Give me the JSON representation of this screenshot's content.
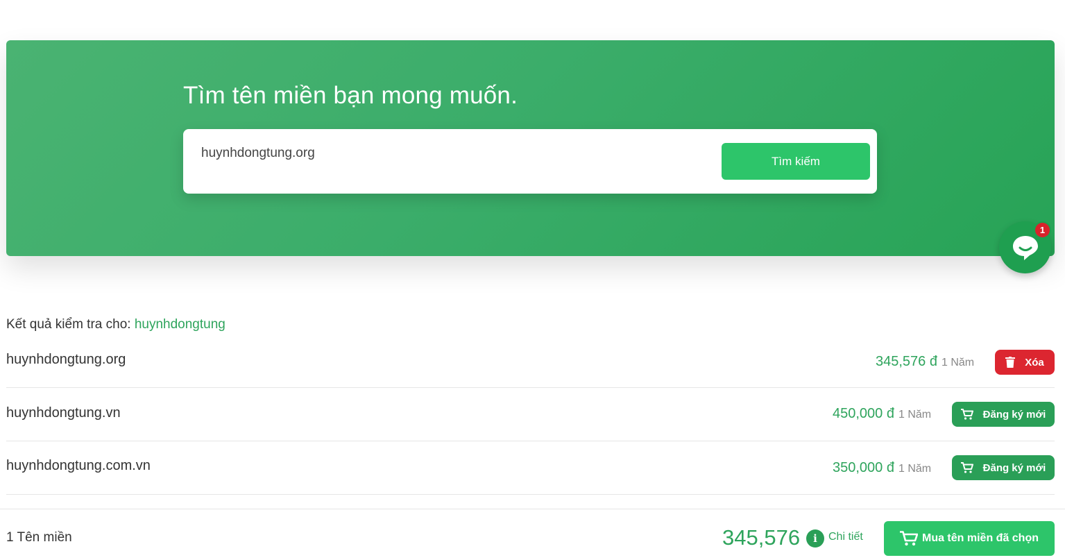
{
  "hero": {
    "title": "Tìm tên miền bạn mong muốn.",
    "search_value": "huynhdongtung.org",
    "search_button": "Tìm kiếm"
  },
  "chat": {
    "badge_count": "1",
    "icon": "chat-bubble-icon"
  },
  "results": {
    "heading_prefix": "Kết quả kiểm tra cho:",
    "keyword": "huynhdongtung",
    "rows": [
      {
        "domain": "huynhdongtung.org",
        "price": "345,576 đ",
        "term": "1 Năm",
        "action": "Xóa",
        "action_type": "delete"
      },
      {
        "domain": "huynhdongtung.vn",
        "price": "450,000 đ",
        "term": "1 Năm",
        "action": "Đăng ký mới",
        "action_type": "register"
      },
      {
        "domain": "huynhdongtung.com.vn",
        "price": "350,000 đ",
        "term": "1 Năm",
        "action": "Đăng ký mới",
        "action_type": "register"
      }
    ]
  },
  "footer": {
    "count": "1 Tên miền",
    "total": "345,576",
    "detail": "Chi tiết",
    "buy_button": "Mua tên miền đã chọn"
  },
  "colors": {
    "brand_green": "#2ea45c",
    "button_green": "#2dc56a",
    "delete_red": "#dc2630"
  }
}
